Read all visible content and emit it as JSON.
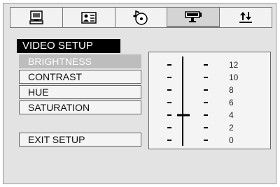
{
  "tabs": [
    {
      "icon": "monitor-icon",
      "active": false
    },
    {
      "icon": "language-card-icon",
      "active": false
    },
    {
      "icon": "audio-disc-icon",
      "active": false
    },
    {
      "icon": "video-camera-icon",
      "active": true
    },
    {
      "icon": "sort-arrows-icon",
      "active": false
    }
  ],
  "menu": {
    "title": "VIDEO SETUP",
    "items": [
      {
        "label": "BRIGHTNESS",
        "selected": true
      },
      {
        "label": "CONTRAST",
        "selected": false
      },
      {
        "label": "HUE",
        "selected": false
      },
      {
        "label": "SATURATION",
        "selected": false
      }
    ],
    "exit_label": "EXIT SETUP"
  },
  "slider": {
    "scale": [
      "12",
      "10",
      "8",
      "6",
      "4",
      "2",
      "0"
    ],
    "value": 4
  }
}
